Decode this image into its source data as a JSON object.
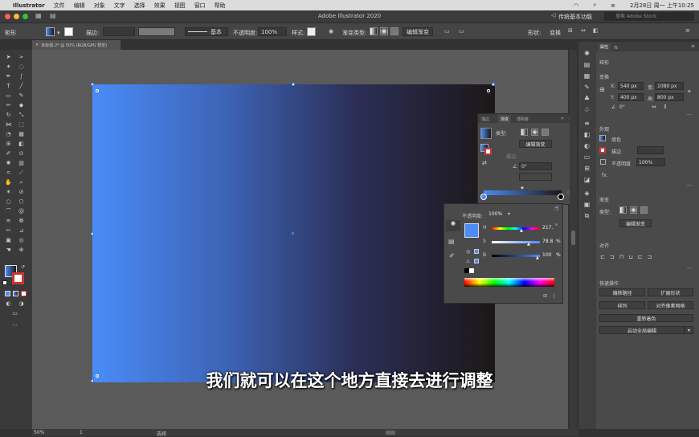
{
  "menubar": {
    "app": "Illustrator",
    "items": [
      "文件",
      "编辑",
      "对象",
      "文字",
      "选择",
      "效果",
      "视图",
      "窗口",
      "帮助"
    ],
    "datetime": "2月28日 周一 上午10:25"
  },
  "titlebar": {
    "title": "Adobe Illustrator 2020",
    "workspace": "传统基本功能",
    "search_placeholder": "搜索 Adobe Stock"
  },
  "control": {
    "selection": "矩形",
    "stroke_label": "描边:",
    "stroke_style": "基本",
    "opacity_label": "不透明度:",
    "opacity_value": "100%",
    "style_label": "样式:",
    "gradient_type_label": "渐变类型:",
    "edit_gradient": "编辑渐变",
    "shape_label": "形状:",
    "transform_label": "变换"
  },
  "document": {
    "tab": "未标题-2* @ 50% (RGB/GPU 预览)",
    "zoom": "50%",
    "artboard_num": "1",
    "status": "选择"
  },
  "gradient_panel": {
    "tabs": [
      "描边",
      "渐变",
      "透明度"
    ],
    "type_label": "类型:",
    "edit_btn": "编辑渐变",
    "stroke_label": "描边:",
    "angle": "0°"
  },
  "color_panel": {
    "opacity_label": "不透明度:",
    "opacity_value": "100%",
    "h_label": "H",
    "h_value": "217.",
    "s_label": "S",
    "s_value": "78.8",
    "b_label": "B",
    "b_value": "100",
    "unit_deg": "°",
    "unit_pct": "%"
  },
  "properties": {
    "tabs": [
      "属性",
      "库"
    ],
    "object": "矩形",
    "transform": "变换",
    "x_label": "X:",
    "x_value": "540 px",
    "w_label": "宽:",
    "w_value": "1080 px",
    "y_label": "Y:",
    "y_value": "400 px",
    "h_label": "高:",
    "h_value": "800 px",
    "angle_value": "0°",
    "appearance": "外观",
    "fill": "填色",
    "stroke": "描边",
    "opacity": "不透明度",
    "opacity_value": "100%",
    "fx": "fx.",
    "gradient": "渐变",
    "type_label": "类型:",
    "edit_gradient": "编辑渐变",
    "align": "对齐",
    "quick_actions": "快速操作",
    "offset_path": "偏移路径",
    "expand_shape": "扩展形状",
    "arrange": "排列",
    "align_pixel": "对齐像素网格",
    "recolor": "重新着色",
    "global_edit": "启动全局编辑"
  },
  "subtitle": "我们就可以在这个地方直接去进行调整",
  "colors": {
    "gradient_start": "#4a8cf8",
    "gradient_end": "#1c1717",
    "accent": "#3a78f0"
  }
}
